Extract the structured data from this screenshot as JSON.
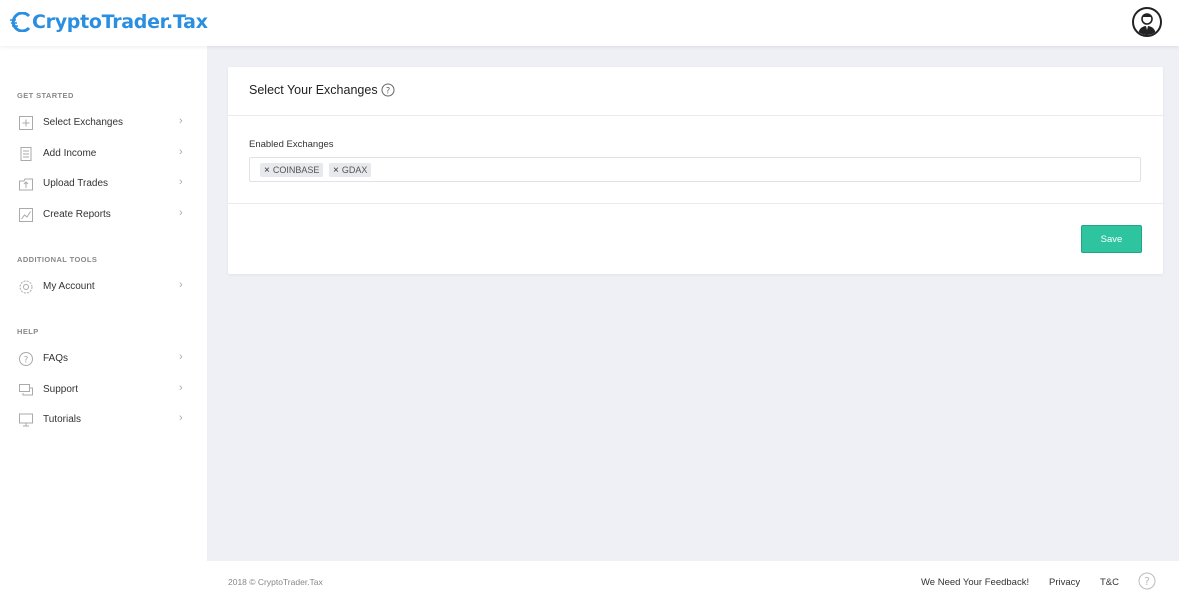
{
  "header": {
    "logo_text": "CryptoTrader.Tax",
    "brand_color": "#2a8fe0"
  },
  "sidebar": {
    "sections": [
      {
        "title": "GET STARTED",
        "items": [
          {
            "label": "Select Exchanges",
            "icon": "plus-square-icon"
          },
          {
            "label": "Add Income",
            "icon": "coins-icon"
          },
          {
            "label": "Upload Trades",
            "icon": "upload-icon"
          },
          {
            "label": "Create Reports",
            "icon": "chart-icon"
          }
        ]
      },
      {
        "title": "ADDITIONAL TOOLS",
        "items": [
          {
            "label": "My Account",
            "icon": "gear-icon"
          }
        ]
      },
      {
        "title": "HELP",
        "items": [
          {
            "label": "FAQs",
            "icon": "question-icon"
          },
          {
            "label": "Support",
            "icon": "chat-icon"
          },
          {
            "label": "Tutorials",
            "icon": "monitor-icon"
          }
        ]
      }
    ]
  },
  "main": {
    "title": "Select Your Exchanges",
    "field_label": "Enabled Exchanges",
    "tags": [
      "COINBASE",
      "GDAX"
    ],
    "save_label": "Save",
    "save_color": "#2ec4a0"
  },
  "footer": {
    "copyright": "2018 © CryptoTrader.Tax",
    "links": [
      "We Need Your Feedback!",
      "Privacy",
      "T&C"
    ]
  }
}
